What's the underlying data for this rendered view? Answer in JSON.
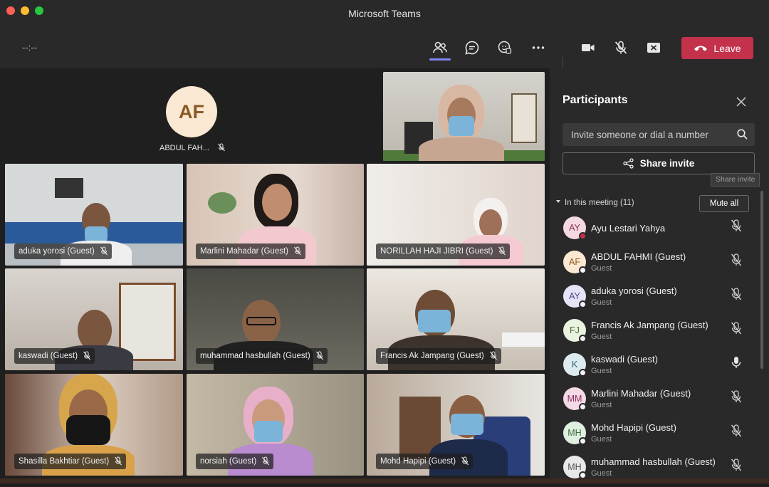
{
  "window": {
    "title": "Microsoft Teams"
  },
  "toolbar": {
    "timer": "--:--",
    "participants_icon": "people-icon",
    "chat_icon": "chat-icon",
    "raise_hand_icon": "raise-hand-icon",
    "more_icon": "more-icon",
    "camera_icon": "camera-icon",
    "mic_icon": "mic-off-icon",
    "share_icon": "share-screen-icon",
    "leave_label": "Leave"
  },
  "stage": {
    "featured_avatar": {
      "initials": "AF",
      "name": "ABDUL FAH..."
    },
    "tiles": [
      {
        "name": "aduka yorosi (Guest)"
      },
      {
        "name": "Marlini Mahadar (Guest)"
      },
      {
        "name": "NORILLAH HAJI JIBRI (Guest)"
      },
      {
        "name": "kaswadi (Guest)"
      },
      {
        "name": "muhammad hasbullah (Guest)"
      },
      {
        "name": "Francis Ak Jampang (Guest)"
      },
      {
        "name": "Shasilla Bakhtiar (Guest)"
      },
      {
        "name": "norsiah (Guest)"
      },
      {
        "name": "Mohd Hapipi (Guest)"
      }
    ]
  },
  "panel": {
    "title": "Participants",
    "invite_placeholder": "Invite someone or dial a number",
    "share_label": "Share invite",
    "tooltip": "Share invite",
    "meeting_label": "In this meeting (11)",
    "mute_all_label": "Mute all",
    "participants": [
      {
        "initials": "AY",
        "name": "Ayu Lestari Yahya",
        "role": "",
        "mic": "mic-off-icon",
        "avatar_bg": "#f4d9e0",
        "avatar_fg": "#8a3050"
      },
      {
        "initials": "AF",
        "name": "ABDUL FAHMI (Guest)",
        "role": "Guest",
        "mic": "mic-off-icon",
        "avatar_bg": "#fbe8d2",
        "avatar_fg": "#8a5a24"
      },
      {
        "initials": "AY",
        "name": "aduka yorosi (Guest)",
        "role": "Guest",
        "mic": "mic-off-icon",
        "avatar_bg": "#e4e4f6",
        "avatar_fg": "#4a4a8a"
      },
      {
        "initials": "FJ",
        "name": "Francis Ak Jampang (Guest)",
        "role": "Guest",
        "mic": "mic-off-icon",
        "avatar_bg": "#e9f3df",
        "avatar_fg": "#4e6b32"
      },
      {
        "initials": "K",
        "name": "kaswadi (Guest)",
        "role": "Guest",
        "mic": "mic-on-icon",
        "avatar_bg": "#dcebf0",
        "avatar_fg": "#2f5d6c"
      },
      {
        "initials": "MM",
        "name": "Marlini Mahadar (Guest)",
        "role": "Guest",
        "mic": "mic-off-icon",
        "avatar_bg": "#f4d9e6",
        "avatar_fg": "#8a3060"
      },
      {
        "initials": "MH",
        "name": "Mohd Hapipi (Guest)",
        "role": "Guest",
        "mic": "mic-off-icon",
        "avatar_bg": "#dff0e0",
        "avatar_fg": "#3e6b40"
      },
      {
        "initials": "MH",
        "name": "muhammad hasbullah (Guest)",
        "role": "Guest",
        "mic": "mic-off-icon",
        "avatar_bg": "#e8e8e8",
        "avatar_fg": "#555555"
      }
    ]
  }
}
